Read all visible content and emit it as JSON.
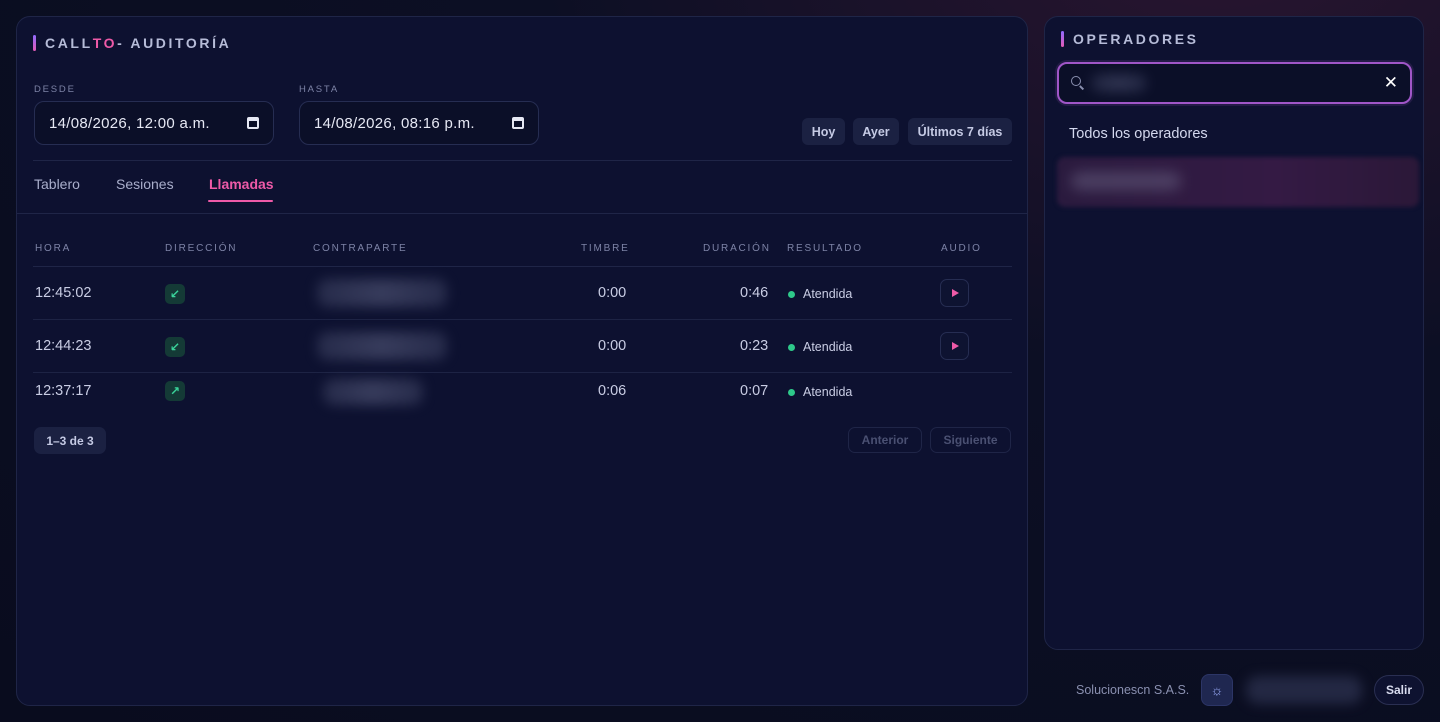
{
  "header": {
    "title_prefix": "CALL",
    "title_highlight": "TO",
    "title_suffix": " - AUDITORÍA"
  },
  "filters": {
    "desde_label": "DESDE",
    "desde_value": "14/08/2026, 12:00 a.m.",
    "hasta_label": "HASTA",
    "hasta_value": "14/08/2026, 08:16 p.m.",
    "quick": {
      "hoy": "Hoy",
      "ayer": "Ayer",
      "ultimos": "Últimos 7 días"
    }
  },
  "tabs": [
    {
      "label": "Tablero",
      "active": false
    },
    {
      "label": "Sesiones",
      "active": false
    },
    {
      "label": "Llamadas",
      "active": true
    }
  ],
  "table": {
    "columns": [
      "HORA",
      "DIRECCIÓN",
      "CONTRAPARTE",
      "TIMBRE",
      "DURACIÓN",
      "RESULTADO",
      "AUDIO"
    ],
    "rows": [
      {
        "hora": "12:45:02",
        "direccion_icon": "arrow-down-left-icon",
        "direccion_glyph": "↙",
        "timbre": "0:00",
        "duracion": "0:46",
        "resultado": "Atendida",
        "audio": true
      },
      {
        "hora": "12:44:23",
        "direccion_icon": "arrow-down-left-icon",
        "direccion_glyph": "↙",
        "timbre": "0:00",
        "duracion": "0:23",
        "resultado": "Atendida",
        "audio": true
      },
      {
        "hora": "12:37:17",
        "direccion_icon": "arrow-up-right-icon",
        "direccion_glyph": "↗",
        "timbre": "0:06",
        "duracion": "0:07",
        "resultado": "Atendida",
        "audio": false
      }
    ]
  },
  "pagination": {
    "count": "1–3 de 3",
    "prev": "Anterior",
    "next": "Siguiente"
  },
  "operators": {
    "title": "OPERADORES",
    "all_option": "Todos los operadores",
    "clear_glyph": "✕"
  },
  "footer": {
    "company": "Solucionescn S.A.S.",
    "theme_glyph": "☼",
    "logout": "Salir"
  },
  "colors": {
    "accent": "#ee5aa8",
    "status_ok": "#2ec98a",
    "panel": "#0d1130",
    "background": "#090c1e"
  }
}
